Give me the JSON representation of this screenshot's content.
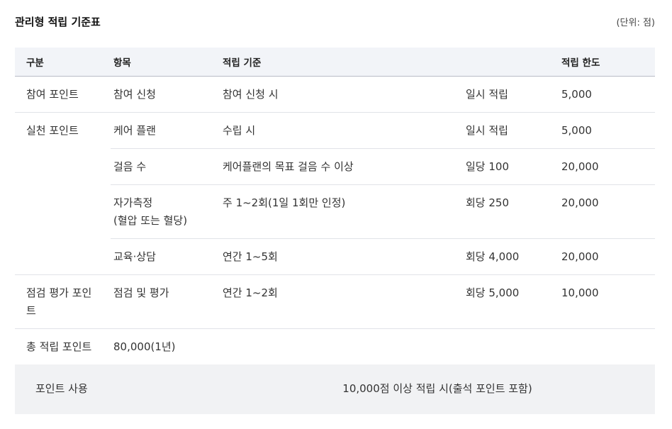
{
  "title": "관리형 적립 기준표",
  "unit": "(단위: 점)",
  "headers": {
    "category": "구분",
    "item": "항목",
    "criteria": "적립 기준",
    "rate": "",
    "limit": "적립 한도"
  },
  "rows": {
    "participation": {
      "category": "참여 포인트",
      "item": "참여 신청",
      "criteria": "참여 신청 시",
      "rate": "일시 적립",
      "limit": "5,000"
    },
    "practice": {
      "category": "실천 포인트",
      "careplan": {
        "item": "케어 플랜",
        "criteria": "수립 시",
        "rate": "일시 적립",
        "limit": "5,000"
      },
      "steps": {
        "item": "걸음 수",
        "criteria": "케어플랜의 목표 걸음 수 이상",
        "rate": "일당 100",
        "limit": "20,000"
      },
      "self_measure": {
        "item_line1": "자가측정",
        "item_line2": "(혈압 또는 혈당)",
        "criteria": "주 1~2회(1일 1회만 인정)",
        "rate": "회당 250",
        "limit": "20,000"
      },
      "education": {
        "item": "교육·상담",
        "criteria": "연간 1~5회",
        "rate": "회당 4,000",
        "limit": "20,000"
      }
    },
    "evaluation": {
      "category_line1": "점검 평가 포인",
      "category_line2": "트",
      "item": "점검 및 평가",
      "criteria": "연간 1~2회",
      "rate": "회당 5,000",
      "limit": "10,000"
    },
    "total": {
      "category": "총 적립 포인트",
      "value": "80,000(1년)"
    },
    "use": {
      "label": "포인트 사용",
      "description": "10,000점 이상 적립 시(출석 포인트 포함)"
    }
  }
}
